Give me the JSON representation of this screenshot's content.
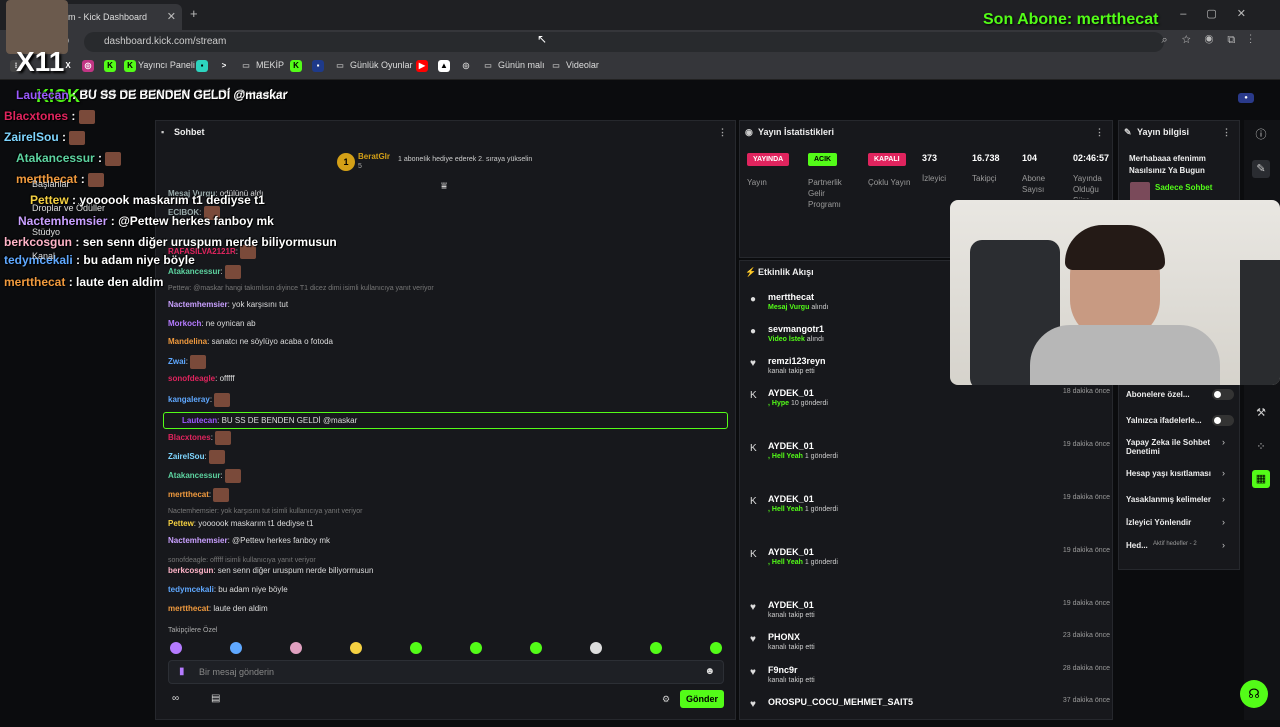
{
  "browser": {
    "tab_title": "m - Kick Dashboard",
    "url": "dashboard.kick.com/stream",
    "bookmarks": [
      "Yayıncı Paneli",
      "MEKİP",
      "Günlük Oyunlar",
      "Günün malı",
      "Videolar"
    ]
  },
  "overlay": {
    "sub_alert": "Son Abone: mertthecat",
    "streamer_tag": "X11",
    "chat": [
      {
        "user": "Lautecan",
        "msg": "BU SS DE BENDEN GELDİ @maskar",
        "color": "#9b59ff"
      },
      {
        "user": "Blacxtones",
        "msg": "",
        "color": "#e0245e"
      },
      {
        "user": "ZairelSou",
        "msg": "",
        "color": "#7fd6ff"
      },
      {
        "user": "Atakancessur",
        "msg": "",
        "color": "#5dd3a0"
      },
      {
        "user": "mertthecat",
        "msg": "",
        "color": "#f09a3e"
      },
      {
        "user": "Pettew",
        "msg": "yoooook maskarım t1 dediyse t1",
        "color": "#f5d142"
      },
      {
        "user": "Nactemhemsier",
        "msg": "@Pettew herkes fanboy mk",
        "color": "#c9a0ff"
      },
      {
        "user": "berkcosgun",
        "msg": "sen senn diğer uruspum nerde biliyormusun",
        "color": "#ffb4c8"
      },
      {
        "user": "tedymcekali",
        "msg": "bu adam niye böyle",
        "color": "#5fa8ff"
      },
      {
        "user": "mertthecat",
        "msg": "laute den aldim",
        "color": "#f09a3e"
      }
    ],
    "menu": [
      "Başlanlar",
      "Droplar ve Ödüller",
      "Stüdyo",
      "Kanal"
    ]
  },
  "page": {
    "title": "BU SS DE BENDEN GELDİ @maskar"
  },
  "chat_panel": {
    "title": "Sohbet",
    "pinned_user": "BeratGlr",
    "pinned_count": "5",
    "pinned_rank": "1",
    "pinned_note": "1 aboneIik hediye ederek 2. sıraya yükselin",
    "messages": [
      {
        "user": "Mesaj Vurgu",
        "text": "odülünü aldı",
        "color": "#9aa"
      },
      {
        "user": "ECIBOK",
        "text": "",
        "color": "#9aa"
      },
      {
        "user": "RAFASILVA2121R",
        "text": "",
        "color": "#e0245e"
      },
      {
        "user": "Atakancessur",
        "text": "",
        "color": "#5dd3a0"
      },
      {
        "user": "",
        "text": "Pettew: @maskar hangi takımlısın diyince T1 dicez dimi isimli kullanıcıya yanıt veriyor",
        "color": "#777"
      },
      {
        "user": "Nactemhemsier",
        "text": "yok karşısını tut",
        "color": "#c9a0ff"
      },
      {
        "user": "Morkoch",
        "text": "ne oynican ab",
        "color": "#b57bff"
      },
      {
        "user": "Mandelina",
        "text": "sanatcı ne söylüyo acaba o fotoda",
        "color": "#f09a3e"
      },
      {
        "user": "Zwai",
        "text": "",
        "color": "#5fa8ff"
      },
      {
        "user": "sonofdeagle",
        "text": "offfff",
        "color": "#e0245e"
      },
      {
        "user": "kangaleray",
        "text": "",
        "color": "#5fa8ff"
      },
      {
        "user": "Lautecan",
        "text": "BU SS DE BENDEN GELDİ @maskar",
        "color": "#9b59ff"
      },
      {
        "user": "Blacxtones",
        "text": "",
        "color": "#e0245e"
      },
      {
        "user": "ZairelSou",
        "text": "",
        "color": "#7fd6ff"
      },
      {
        "user": "Atakancessur",
        "text": "",
        "color": "#5dd3a0"
      },
      {
        "user": "mertthecat",
        "text": "",
        "color": "#f09a3e"
      },
      {
        "user": "",
        "text": "Nactemhemsier: yok karşısını tut isimli kullanıcıya yanıt veriyor",
        "color": "#777"
      },
      {
        "user": "Pettew",
        "text": "yoooook maskarım t1 dediyse t1",
        "color": "#f5d142"
      },
      {
        "user": "Nactemhemsier",
        "text": "@Pettew herkes fanboy mk",
        "color": "#c9a0ff"
      },
      {
        "user": "",
        "text": "sonofdeagle: offfff isimli kullanıcıya yanıt veriyor",
        "color": "#777"
      },
      {
        "user": "berkcosgun",
        "text": "sen senn diğer uruspum nerde biliyormusun",
        "color": "#ffb4c8"
      },
      {
        "user": "tedymcekali",
        "text": "bu adam niye böyle",
        "color": "#5fa8ff"
      },
      {
        "user": "mertthecat",
        "text": "laute den aldim",
        "color": "#f09a3e"
      }
    ],
    "emote_section": "Takipçilere Özel",
    "input_placeholder": "Bir mesaj gönderin",
    "send_label": "Gönder"
  },
  "stats": {
    "title": "Yayın İstatistikleri",
    "badges": [
      {
        "text": "YAYINDA",
        "label": "Yayın",
        "color": "#e0245e"
      },
      {
        "text": "ACIK",
        "label": "Partnerlik Gelir Programı",
        "color": "#53fc18"
      },
      {
        "text": "KAPALI",
        "label": "Çoklu Yayın",
        "color": "#e0245e"
      }
    ],
    "values": [
      {
        "val": "373",
        "label": "İzleyici"
      },
      {
        "val": "16.738",
        "label": "Takipçi"
      },
      {
        "val": "104",
        "label": "Abone Sayısı"
      },
      {
        "val": "02:46:57",
        "label": "Yayında Olduğu Süre"
      }
    ]
  },
  "events": {
    "title": "Etkinlik Akışı",
    "items": [
      {
        "name": "mertthecat",
        "hl": "Mesaj Vurgu",
        "sub": "alındı",
        "time": "",
        "icon": "●"
      },
      {
        "name": "sevmangotr1",
        "hl": "Video İstek",
        "sub": "alındı",
        "time": "",
        "icon": "●"
      },
      {
        "name": "remzi123reyn",
        "hl": "",
        "sub": "kanalı takip etti",
        "time": "",
        "icon": "♥"
      },
      {
        "name": "AYDEK_01",
        "hl": ", Hype",
        "sub": "10 gönderdi",
        "time": "18 dakika önce",
        "icon": "K"
      },
      {
        "name": "AYDEK_01",
        "hl": ", Hell Yeah",
        "sub": "1 gönderdi",
        "time": "19 dakika önce",
        "icon": "K"
      },
      {
        "name": "AYDEK_01",
        "hl": ", Hell Yeah",
        "sub": "1 gönderdi",
        "time": "19 dakika önce",
        "icon": "K"
      },
      {
        "name": "AYDEK_01",
        "hl": ", Hell Yeah",
        "sub": "1 gönderdi",
        "time": "19 dakika önce",
        "icon": "K"
      },
      {
        "name": "AYDEK_01",
        "hl": "",
        "sub": "kanalı takip etti",
        "time": "19 dakika önce",
        "icon": "♥"
      },
      {
        "name": "PHONX",
        "hl": "",
        "sub": "kanalı takip etti",
        "time": "23 dakika önce",
        "icon": "♥"
      },
      {
        "name": "F9nc9r",
        "hl": "",
        "sub": "kanalı takip etti",
        "time": "28 dakika önce",
        "icon": "♥"
      },
      {
        "name": "OROSPU_COCU_MEHMET_SAIT5",
        "hl": "",
        "sub": "",
        "time": "37 dakika önce",
        "icon": "♥"
      }
    ]
  },
  "info": {
    "title": "Yayın bilgisi",
    "stream_title": "Merhabaaa efenimm Nasılsınız Ya Bugun",
    "category": "Sadece Sohbet",
    "settings": [
      {
        "label": "Abonelere özel...",
        "toggle": true
      },
      {
        "label": "Yalnızca ifadelerle...",
        "toggle": true
      },
      {
        "label": "Yapay Zeka ile Sohbet Denetimi",
        "toggle": false
      },
      {
        "label": "Hesap yaşı kısıtlaması",
        "toggle": false
      },
      {
        "label": "Yasaklanmış kelimeler",
        "toggle": false
      },
      {
        "label": "İzleyici Yönlendir",
        "toggle": false
      },
      {
        "label": "Hed...",
        "toggle": false
      }
    ],
    "goal_text": "Aktif hedefler - 2"
  }
}
